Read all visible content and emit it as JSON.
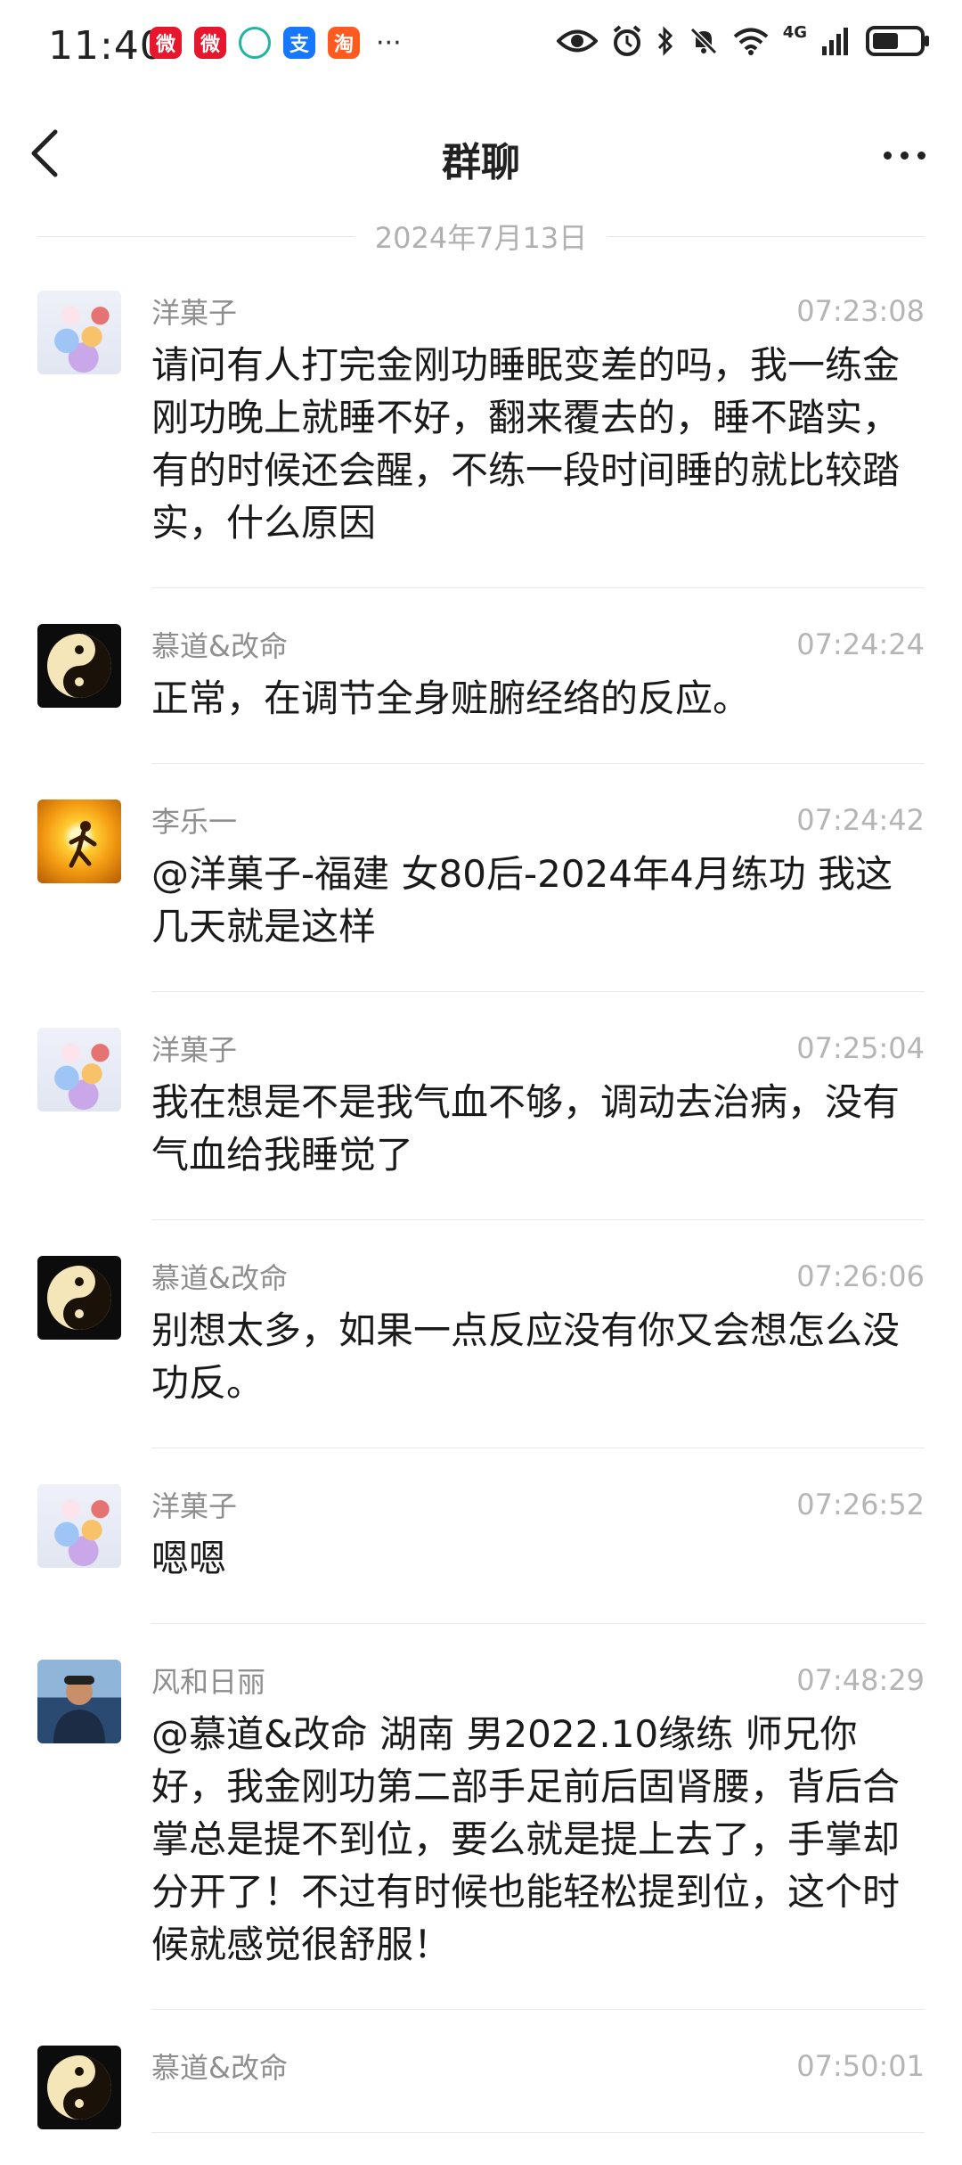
{
  "status_bar": {
    "time": "11:40",
    "apps": [
      {
        "icon": "weibo-icon",
        "color": "#e6162d",
        "glyph": "微"
      },
      {
        "icon": "weibo-icon",
        "color": "#e6162d",
        "glyph": "微"
      },
      {
        "icon": "chat-bubble-icon",
        "color": "#20b5a0",
        "glyph": "◌"
      },
      {
        "icon": "alipay-icon",
        "color": "#1677ff",
        "glyph": "支"
      },
      {
        "icon": "taobao-icon",
        "color": "#ff5a1f",
        "glyph": "淘"
      }
    ],
    "more": "···",
    "network": "4G"
  },
  "header": {
    "title": "群聊"
  },
  "date_divider": "2024年7月13日",
  "messages": [
    {
      "avatar": "flower",
      "name": "洋菓子",
      "time": "07:23:08",
      "text": "请问有人打完金刚功睡眠变差的吗，我一练金刚功晚上就睡不好，翻来覆去的，睡不踏实，有的时候还会醒，不练一段时间睡的就比较踏实，什么原因"
    },
    {
      "avatar": "taiji",
      "name": "慕道&改命",
      "time": "07:24:24",
      "text": "正常，在调节全身赃腑经络的反应。"
    },
    {
      "avatar": "sun",
      "name": "李乐一",
      "time": "07:24:42",
      "text": "@洋菓子-福建 女80后-2024年4月练功 我这几天就是这样"
    },
    {
      "avatar": "flower",
      "name": "洋菓子",
      "time": "07:25:04",
      "text": "我在想是不是我气血不够，调动去治病，没有气血给我睡觉了"
    },
    {
      "avatar": "taiji",
      "name": "慕道&改命",
      "time": "07:26:06",
      "text": "别想太多，如果一点反应没有你又会想怎么没功反。"
    },
    {
      "avatar": "flower",
      "name": "洋菓子",
      "time": "07:26:52",
      "text": "嗯嗯"
    },
    {
      "avatar": "man",
      "name": "风和日丽",
      "time": "07:48:29",
      "text": "@慕道&改命 湖南 男2022.10缘练 师兄你好，我金刚功第二部手足前后固肾腰，背后合掌总是提不到位，要么就是提上去了，手掌却分开了！不过有时候也能轻松提到位，这个时候就感觉很舒服！"
    },
    {
      "avatar": "taiji",
      "name": "慕道&改命",
      "time": "07:50:01",
      "text": ""
    }
  ]
}
